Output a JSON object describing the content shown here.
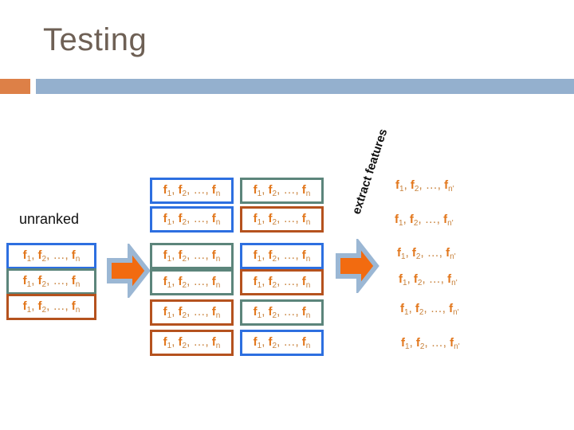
{
  "slide": {
    "title": "Testing",
    "accent_orange": "#DD8047",
    "accent_blue": "#94B0CE",
    "title_color": "#6E6055"
  },
  "labels": {
    "unranked": "unranked",
    "extract_features": "extract features"
  },
  "feature_text": {
    "f1": "f",
    "sub1": "1",
    "comma1": ", ",
    "f2": "f",
    "sub2": "2",
    "comma2": ", …, ",
    "fn": "f",
    "subn": "n",
    "subn_prime": "n'"
  },
  "colors": {
    "border_blue": "#2D6FE0",
    "border_teal": "#5C857B",
    "border_brown": "#B5521E",
    "feature_orange": "#E2761B",
    "arrow_fill": "#F26B10",
    "arrow_outline": "#9BB7D4"
  },
  "columns": {
    "unranked_list": {
      "name": "unranked",
      "rows": [
        {
          "border": "blue",
          "text": "f1, f2, …, fn"
        },
        {
          "border": "teal",
          "text": "f1, f2, …, fn"
        },
        {
          "border": "brown",
          "text": "f1, f2, …, fn"
        }
      ]
    },
    "middle_left": {
      "rows": [
        {
          "border": "blue",
          "text": "f1, f2, …, fn"
        },
        {
          "border": "blue",
          "text": "f1, f2, …, fn"
        },
        {
          "border": "teal",
          "text": "f1, f2, …, fn"
        },
        {
          "border": "teal",
          "text": "f1, f2, …, fn"
        },
        {
          "border": "brown",
          "text": "f1, f2, …, fn"
        },
        {
          "border": "brown",
          "text": "f1, f2, …, fn"
        }
      ]
    },
    "middle_right": {
      "rows": [
        {
          "border": "teal",
          "text": "f1, f2, …, fn"
        },
        {
          "border": "brown",
          "text": "f1, f2, …, fn"
        },
        {
          "border": "blue",
          "text": "f1, f2, …, fn"
        },
        {
          "border": "brown",
          "text": "f1, f2, …, fn"
        },
        {
          "border": "teal",
          "text": "f1, f2, …, fn"
        },
        {
          "border": "blue",
          "text": "f1, f2, …, fn"
        }
      ]
    },
    "extracted": {
      "rows": [
        {
          "text": "f1, f2, …, fn'"
        },
        {
          "text": "f1, f2, …, fn'"
        },
        {
          "text": "f1, f2, …, fn'"
        },
        {
          "text": "f1, f2, …, fn'"
        },
        {
          "text": "f1, f2, …, fn'"
        },
        {
          "text": "f1, f2, …, fn'"
        }
      ]
    }
  },
  "arrows": [
    {
      "name": "arrow-unranked-to-ranked"
    },
    {
      "name": "arrow-ranked-to-extracted"
    }
  ]
}
